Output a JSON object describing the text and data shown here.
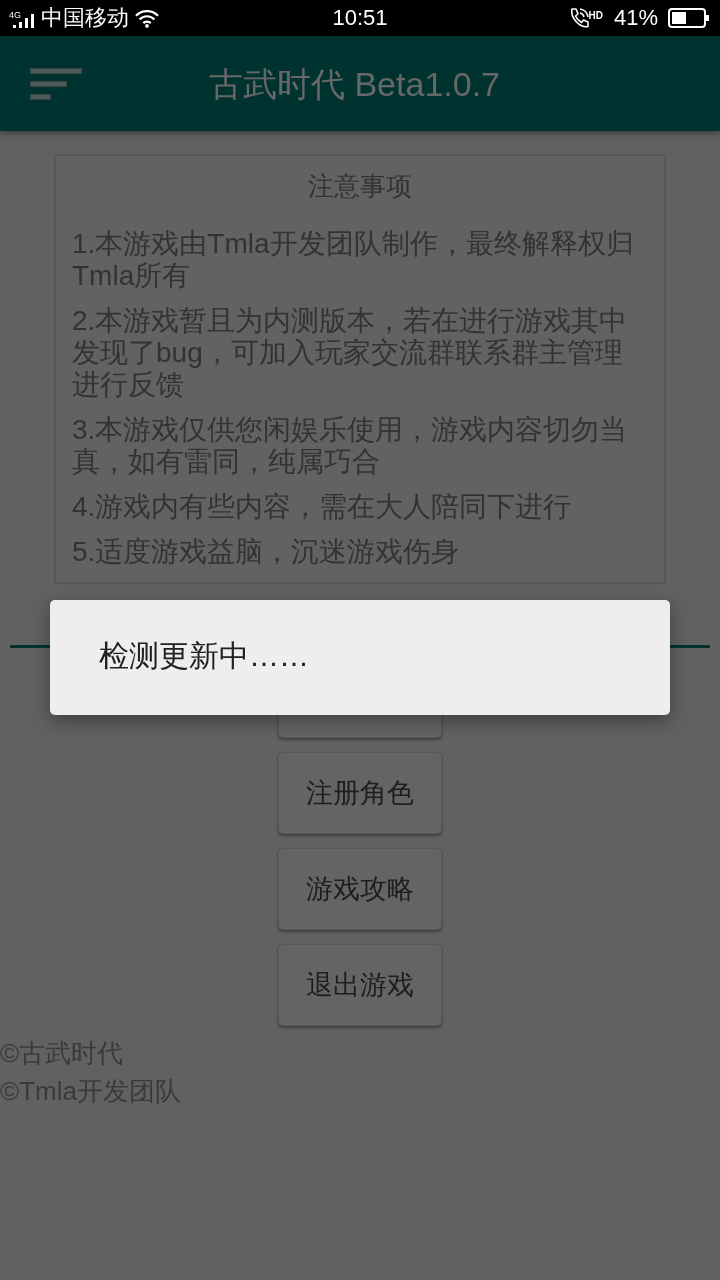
{
  "status_bar": {
    "network_type": "4G",
    "carrier": "中国移动",
    "time": "10:51",
    "call_badge": "HD",
    "battery": "41%"
  },
  "app_bar": {
    "title": "古武时代 Beta1.0.7"
  },
  "notice": {
    "title": "注意事项",
    "items": [
      "1.本游戏由Tmla开发团队制作，最终解释权归Tmla所有",
      "2.本游戏暂且为内测版本，若在进行游戏其中发现了bug，可加入玩家交流群联系群主管理进行反馈",
      "3.本游戏仅供您闲娱乐使用，游戏内容切勿当真，如有雷同，纯属巧合",
      "4.游戏内有些内容，需在大人陪同下进行",
      "5.适度游戏益脑，沉迷游戏伤身"
    ]
  },
  "buttons": [
    {
      "label": "注册角色"
    },
    {
      "label": "游戏攻略"
    },
    {
      "label": "退出游戏"
    }
  ],
  "footer": [
    "©古武时代",
    "©Tmla开发团队"
  ],
  "dialog": {
    "message": "检测更新中……",
    "covers_button": true
  }
}
